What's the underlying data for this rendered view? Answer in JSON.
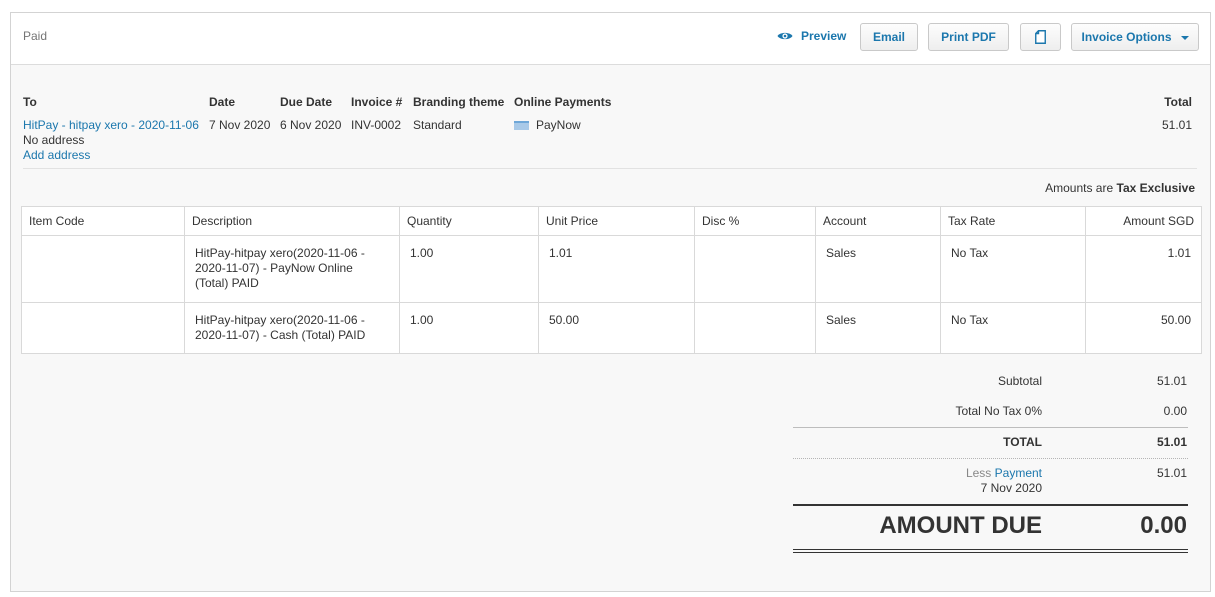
{
  "toolbar": {
    "status": "Paid",
    "preview_label": "Preview",
    "email_label": "Email",
    "print_pdf_label": "Print PDF",
    "invoice_options_label": "Invoice Options"
  },
  "header": {
    "to_label": "To",
    "date_label": "Date",
    "due_date_label": "Due Date",
    "invoice_no_label": "Invoice #",
    "branding_label": "Branding theme",
    "online_payments_label": "Online Payments",
    "total_label": "Total",
    "contact": "HitPay - hitpay xero - 2020-11-06",
    "address": "No address",
    "add_address": "Add address",
    "date": "7 Nov 2020",
    "due_date": "6 Nov 2020",
    "invoice_no": "INV-0002",
    "branding": "Standard",
    "online_payment": "PayNow",
    "total": "51.01"
  },
  "amounts": {
    "label": "Amounts are",
    "value": "Tax Exclusive"
  },
  "table": {
    "columns": [
      "Item Code",
      "Description",
      "Quantity",
      "Unit Price",
      "Disc %",
      "Account",
      "Tax Rate",
      "Amount SGD"
    ],
    "rows": [
      {
        "item_code": "",
        "description": "HitPay-hitpay xero(2020-11-06 - 2020-11-07) - PayNow Online (Total) PAID",
        "quantity": "1.00",
        "unit_price": "1.01",
        "disc": "",
        "account": "Sales",
        "tax_rate": "No Tax",
        "amount": "1.01"
      },
      {
        "item_code": "",
        "description": "HitPay-hitpay xero(2020-11-06 - 2020-11-07) - Cash (Total) PAID",
        "quantity": "1.00",
        "unit_price": "50.00",
        "disc": "",
        "account": "Sales",
        "tax_rate": "No Tax",
        "amount": "50.00"
      }
    ]
  },
  "totals": {
    "subtotal_label": "Subtotal",
    "subtotal": "51.01",
    "no_tax_label": "Total No Tax 0%",
    "no_tax": "0.00",
    "total_label": "TOTAL",
    "total": "51.01",
    "less_label": "Less",
    "payment_label": "Payment",
    "payment_date": "7 Nov 2020",
    "payment_amount": "51.01",
    "amount_due_label": "AMOUNT DUE",
    "amount_due": "0.00"
  },
  "colors": {
    "link": "#1b77ad",
    "text": "#333333",
    "background": "#f8f8f8"
  },
  "icons": {
    "preview": "eye-icon",
    "copy": "copy-document-icon",
    "options": "chevron-down-icon",
    "payment": "credit-card-icon"
  }
}
